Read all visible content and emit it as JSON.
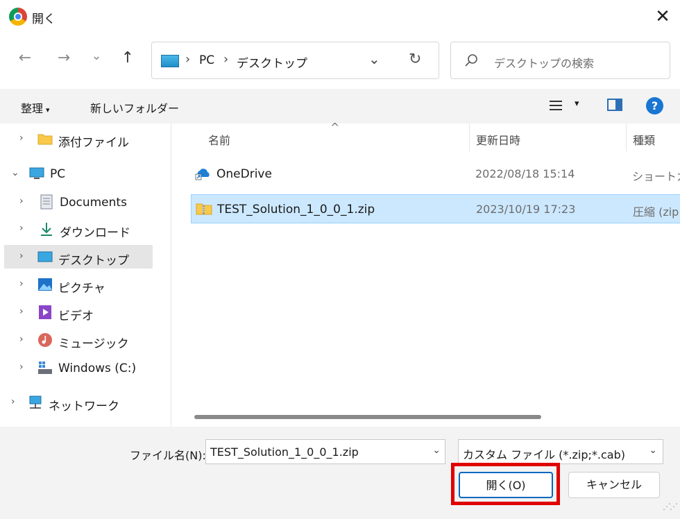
{
  "window": {
    "title": "開く",
    "close_glyph": "✕"
  },
  "navigation": {
    "back": "←",
    "forward": "→",
    "recent": "⌄",
    "up": "↑"
  },
  "address_bar": {
    "crumbs": [
      "PC",
      "デスクトップ"
    ],
    "separator": "›",
    "dropdown": "⌄",
    "refresh": "↻"
  },
  "search": {
    "placeholder": "デスクトップの検索"
  },
  "command_bar": {
    "organize": "整理",
    "organize_caret": "▾",
    "new_folder": "新しいフォルダー",
    "view_caret": "▾",
    "help": "?"
  },
  "nav_pane": {
    "chevron_collapsed": "›",
    "chevron_expanded": "⌄",
    "items": [
      {
        "label": "添付ファイル",
        "icon": "folder-icon"
      },
      {
        "label": "PC",
        "icon": "computer-icon",
        "expanded": true
      },
      {
        "label": "Documents",
        "icon": "documents-icon"
      },
      {
        "label": "ダウンロード",
        "icon": "download-icon"
      },
      {
        "label": "デスクトップ",
        "icon": "desktop-icon",
        "selected": true
      },
      {
        "label": "ピクチャ",
        "icon": "pictures-icon"
      },
      {
        "label": "ビデオ",
        "icon": "videos-icon"
      },
      {
        "label": "ミュージック",
        "icon": "music-icon"
      },
      {
        "label": "Windows (C:)",
        "icon": "drive-icon"
      },
      {
        "label": "ネットワーク",
        "icon": "network-icon"
      }
    ]
  },
  "file_list": {
    "sort_indicator": "^",
    "columns": {
      "name": "名前",
      "modified": "更新日時",
      "type": "種類"
    },
    "rows": [
      {
        "name": "OneDrive",
        "modified": "2022/08/18 15:14",
        "type": "ショートカット",
        "icon": "onedrive-shortcut-icon"
      },
      {
        "name": "TEST_Solution_1_0_0_1.zip",
        "modified": "2023/10/19 17:23",
        "type": "圧縮 (zip",
        "icon": "zip-folder-icon",
        "selected": true
      }
    ]
  },
  "bottom": {
    "filename_label": "ファイル名(N):",
    "filename_value": "TEST_Solution_1_0_0_1.zip",
    "filetype_value": "カスタム ファイル (*.zip;*.cab)",
    "dropdown": "⌄",
    "open_button": "開く(O)",
    "cancel_button": "キャンセル",
    "highlight_color": "#e00000"
  },
  "colors": {
    "selection": "#cce8ff",
    "accent": "#0067c0",
    "chrome_bg": "#f3f3f3"
  }
}
